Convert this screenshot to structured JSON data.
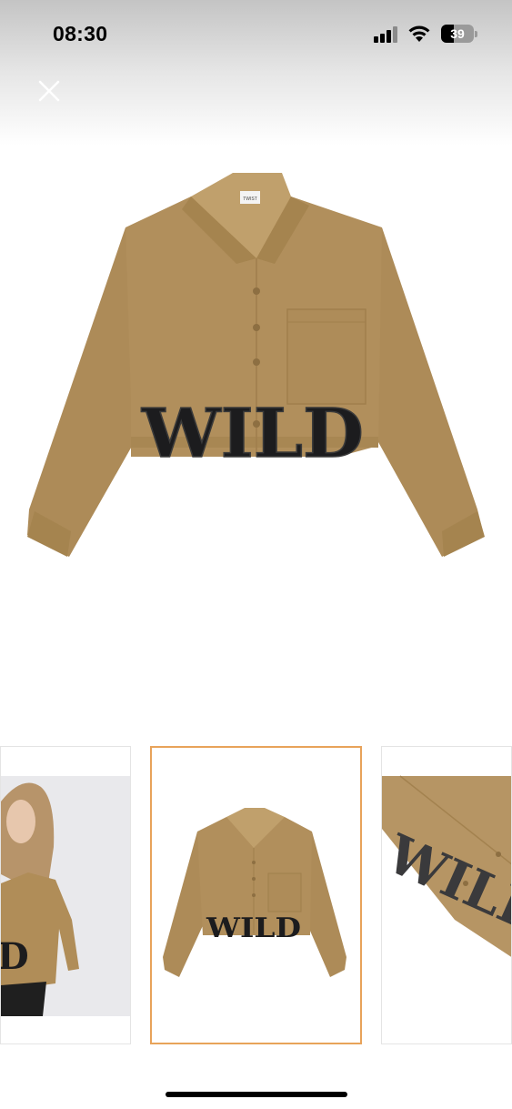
{
  "status_bar": {
    "time": "08:30",
    "battery_level": "39",
    "battery_fraction": 0.39,
    "signal_icon": "cellular-signal-icon",
    "wifi_icon": "wifi-icon"
  },
  "viewer": {
    "close_icon": "close-icon",
    "main_image": {
      "garment_text": "WILD",
      "label_text": "TWIST"
    },
    "thumbnails": [
      {
        "name": "model-photo",
        "patch_text": "D",
        "selected": false
      },
      {
        "name": "flat-front-photo",
        "patch_text": "WILD",
        "selected": true
      },
      {
        "name": "detail-closeup",
        "patch_text": "WILD",
        "selected": false
      }
    ]
  },
  "colors": {
    "shirt": "#b18f5c",
    "shirt_shadow": "#9c7c4d",
    "patch": "#1c1c1e",
    "selected_border": "#e8a35a"
  }
}
